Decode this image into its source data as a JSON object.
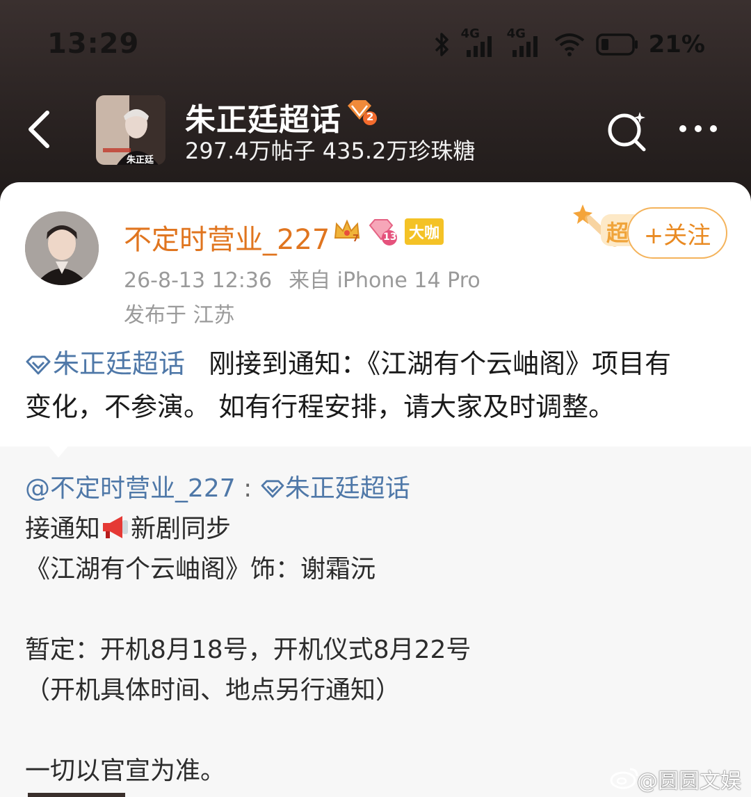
{
  "status_bar": {
    "time": "13:29",
    "network_1": "4G",
    "network_2": "4G",
    "battery": "21%",
    "icons": [
      "bluetooth-icon",
      "signal-icon",
      "signal-icon",
      "wifi-icon",
      "battery-icon"
    ]
  },
  "header": {
    "topic_title": "朱正廷超话",
    "topic_level": "2",
    "topic_stats": "297.4万帖子 435.2万珍珠糖",
    "avatar_text": "朱正廷"
  },
  "post": {
    "user_name": "不定时营业_227",
    "crown_level": "7",
    "diamond_level": "13",
    "badge_label": "大咖",
    "chao_label": "超",
    "follow_label": "+关注",
    "time": "26-8-13 12:36",
    "source": "来自 iPhone 14 Pro",
    "location": "发布于 江苏",
    "topic_link": "朱正廷超话",
    "text_line_1": "刚接到通知：《江湖有个云岫阁》项目有",
    "text_line_2": "变化，不参演。 如有行程安排，请大家及时调整。"
  },
  "repost": {
    "author": "@不定时营业_227",
    "separator": ":",
    "topic_link": "朱正廷超话",
    "line_1_a": "接通知",
    "line_1_b": "新剧同步",
    "line_2": "《江湖有个云岫阁》饰：谢霜沅",
    "line_3": "暂定：开机8月18号，开机仪式8月22号",
    "line_4": "（开机具体时间、地点另行通知）",
    "line_5": "一切以官宣为准。"
  },
  "watermark": "@圆圆文娱",
  "colors": {
    "username": "#e0751f",
    "link": "#4f78a8",
    "follow": "#e98a22",
    "header_bg": "#2a2322"
  }
}
